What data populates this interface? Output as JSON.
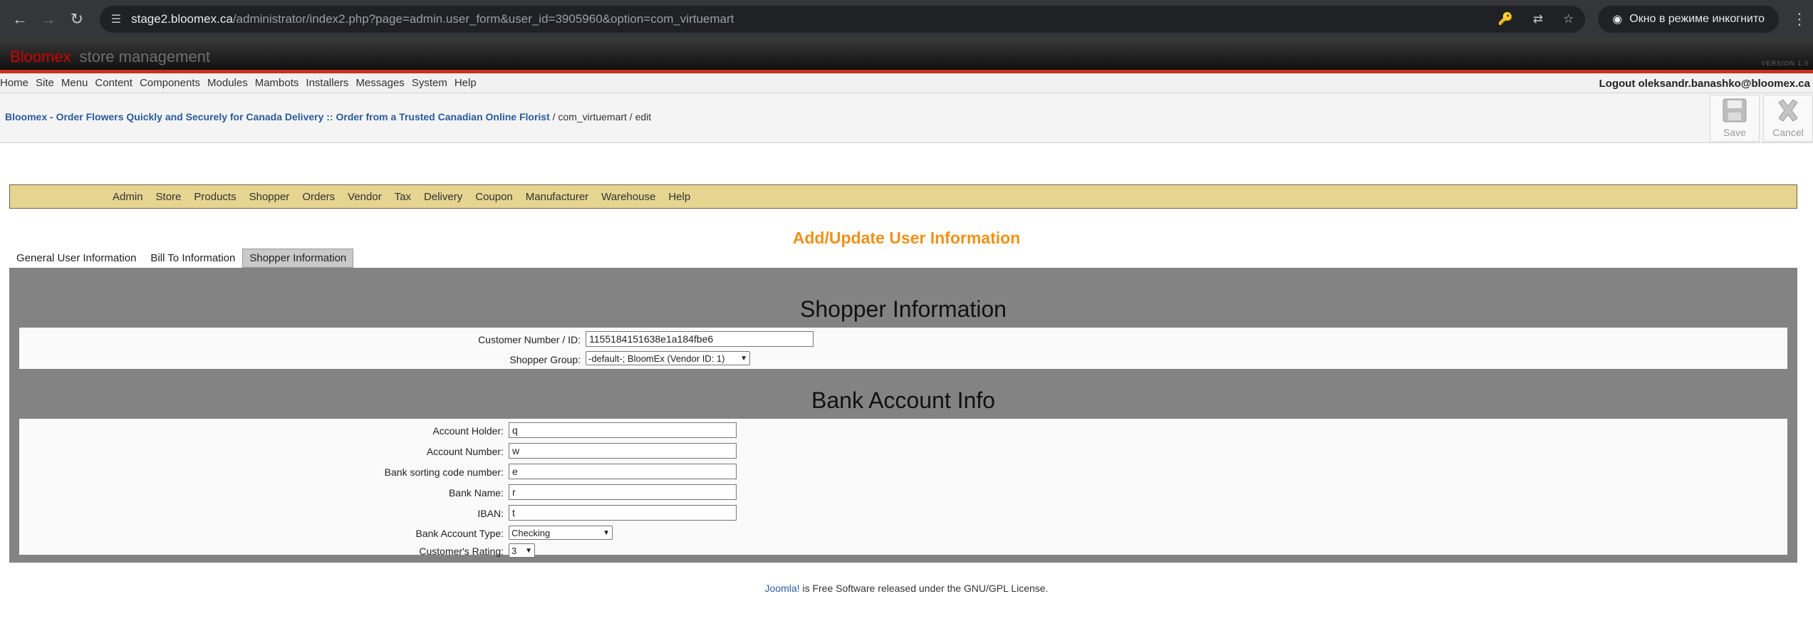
{
  "browser": {
    "url_host": "stage2.bloomex.ca",
    "url_path": "/administrator/index2.php?page=admin.user_form&user_id=3905960&option=com_virtuemart",
    "incognito_label": "Окно в режиме инкогнито"
  },
  "header": {
    "brand": "Bloomex",
    "brand_sub": "store management",
    "version": "VERSION 1.0"
  },
  "topmenu": {
    "items": [
      "Home",
      "Site",
      "Menu",
      "Content",
      "Components",
      "Modules",
      "Mambots",
      "Installers",
      "Messages",
      "System",
      "Help"
    ],
    "logout": "Logout oleksandr.banashko@bloomex.ca"
  },
  "pathway": {
    "site_link": "Bloomex - Order Flowers Quickly and Securely for Canada Delivery :: Order from a Trusted Canadian Online Florist",
    "rest": " / com_virtuemart / edit"
  },
  "toolbar": {
    "save": "Save",
    "cancel": "Cancel"
  },
  "vm_menu": {
    "items": [
      "Admin",
      "Store",
      "Products",
      "Shopper",
      "Orders",
      "Vendor",
      "Tax",
      "Delivery",
      "Coupon",
      "Manufacturer",
      "Warehouse",
      "Help"
    ]
  },
  "page_title": "Add/Update User Information",
  "tabs": [
    "General User Information",
    "Bill To Information",
    "Shopper Information"
  ],
  "shopper": {
    "title": "Shopper Information",
    "customer_number_label": "Customer Number / ID:",
    "customer_number": "1155184151638e1a184fbe6",
    "group_label": "Shopper Group:",
    "group_value": "-default-; BloomEx (Vendor ID: 1)"
  },
  "bank": {
    "title": "Bank Account Info",
    "holder_label": "Account Holder:",
    "holder": "q",
    "number_label": "Account Number:",
    "number": "w",
    "sort_label": "Bank sorting code number:",
    "sort": "e",
    "name_label": "Bank Name:",
    "name": "r",
    "iban_label": "IBAN:",
    "iban": "t",
    "type_label": "Bank Account Type:",
    "type": "Checking",
    "rating_label": "Customer's Rating:",
    "rating": "3"
  },
  "footer": {
    "link": "Joomla!",
    "text": " is Free Software released under the GNU/GPL License."
  }
}
